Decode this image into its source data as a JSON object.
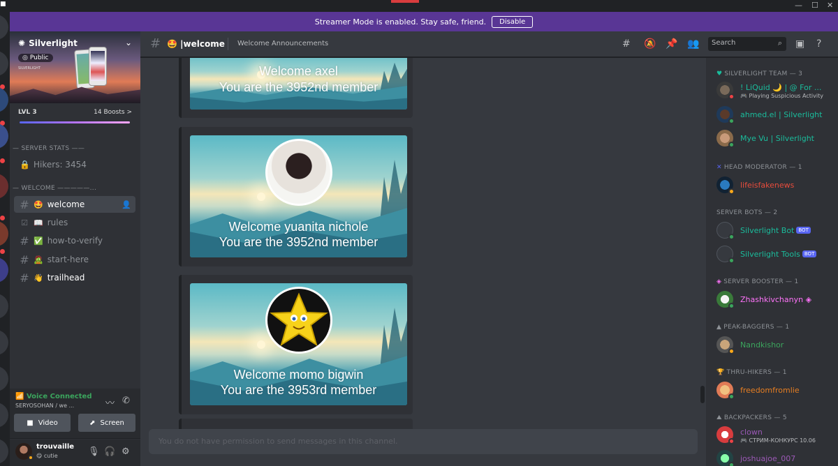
{
  "colors": {
    "banner": "#593695",
    "accent": "#5865f2",
    "online": "#3ba55d",
    "idle": "#faa81a",
    "dnd": "#ed4245"
  },
  "banner": {
    "text": "Streamer Mode is enabled. Stay safe, friend.",
    "button": "Disable"
  },
  "server": {
    "name": "Silverlight",
    "badge": "Public",
    "banner_small_text": "SILVERLIGHT",
    "level": "LVL 3",
    "boosts": "14 Boosts",
    "boost_chevron": ">",
    "categories": {
      "stats": "— SERVER STATS ——",
      "welcome": "— WELCOME —————..."
    },
    "stat_channel": "Hikers: 3454",
    "channels": [
      {
        "name": "welcome",
        "emoji": "🤩",
        "active": true
      },
      {
        "name": "rules",
        "emoji": "📖",
        "active": false
      },
      {
        "name": "how-to-verify",
        "emoji": "✅",
        "active": false
      },
      {
        "name": "start-here",
        "emoji": "🧟",
        "active": false
      },
      {
        "name": "trailhead",
        "emoji": "👋",
        "active": false,
        "unread": true
      }
    ]
  },
  "voice": {
    "status": "Voice Connected",
    "channel": "SERYOSOHAN / we ...",
    "video": "Video",
    "screen": "Screen"
  },
  "user": {
    "name": "trouvaille",
    "status": "cutie",
    "status_emoji": "😋"
  },
  "header": {
    "channel": "welcome",
    "emoji": "🤩",
    "topic": "Welcome Announcements",
    "search_placeholder": "Search"
  },
  "messages": [
    {
      "line1": "Welcome axel",
      "line2": "You are the 3952nd member"
    },
    {
      "line1": "Welcome yuanita nichole",
      "line2": "You are the 3952nd member"
    },
    {
      "line1": "Welcome momo bigwin",
      "line2": "You are the 3953rd member"
    }
  ],
  "composer": {
    "placeholder": "You do not have permission to send messages in this channel."
  },
  "members": {
    "roles": [
      {
        "title": "SILVERLIGHT TEAM — 3",
        "icon": "♥",
        "icon_color": "#1abc9c"
      },
      {
        "title": "HEAD MODERATOR — 1",
        "icon": "✕",
        "icon_color": "#5865f2"
      },
      {
        "title": "SERVER BOTS — 2",
        "icon": "",
        "icon_color": "#8e9297"
      },
      {
        "title": "SERVER BOOSTER — 1",
        "icon": "◈",
        "icon_color": "#ff73fa"
      },
      {
        "title": "PEAK-BAGGERS — 1",
        "icon": "▲",
        "icon_color": "#b9bbbe"
      },
      {
        "title": "THRU-HIKERS — 1",
        "icon": "🏆",
        "icon_color": "#faa81a"
      },
      {
        "title": "BACKPACKERS — 5",
        "icon": "⛰",
        "icon_color": "#b9bbbe"
      }
    ],
    "list": [
      {
        "name": "! LiQuid 🌙 | @ For ...",
        "activity": "🎮 Playing Suspicious Activity",
        "color": "#1abc9c",
        "status": "dnd"
      },
      {
        "name": "ahmed.el | Silverlight",
        "activity": "",
        "color": "#1abc9c",
        "status": "online"
      },
      {
        "name": "Mye Vu | Silverlight",
        "activity": "",
        "color": "#1abc9c",
        "status": "online"
      },
      {
        "name": "lifeisfakenews",
        "activity": "",
        "color": "#e74c3c",
        "status": "idle"
      },
      {
        "name": "Silverlight Bot",
        "activity": "",
        "color": "#1abc9c",
        "status": "online",
        "tag": "BOT"
      },
      {
        "name": "Silverlight Tools",
        "activity": "",
        "color": "#1abc9c",
        "status": "online",
        "tag": "BOT"
      },
      {
        "name": "Zhashkivchanyn",
        "activity": "",
        "color": "#ff73fa",
        "status": "online"
      },
      {
        "name": "Nandkishor",
        "activity": "",
        "color": "#3ba55d",
        "status": "idle"
      },
      {
        "name": "freedomfromlie",
        "activity": "",
        "color": "#e67e22",
        "status": "online"
      },
      {
        "name": "clown",
        "activity": "🎮 СТРИМ-КОНКУРС 10.06",
        "color": "#9b59b6",
        "status": "dnd"
      },
      {
        "name": "joshuajoe_007",
        "activity": "",
        "color": "#9b59b6",
        "status": "online"
      }
    ]
  }
}
